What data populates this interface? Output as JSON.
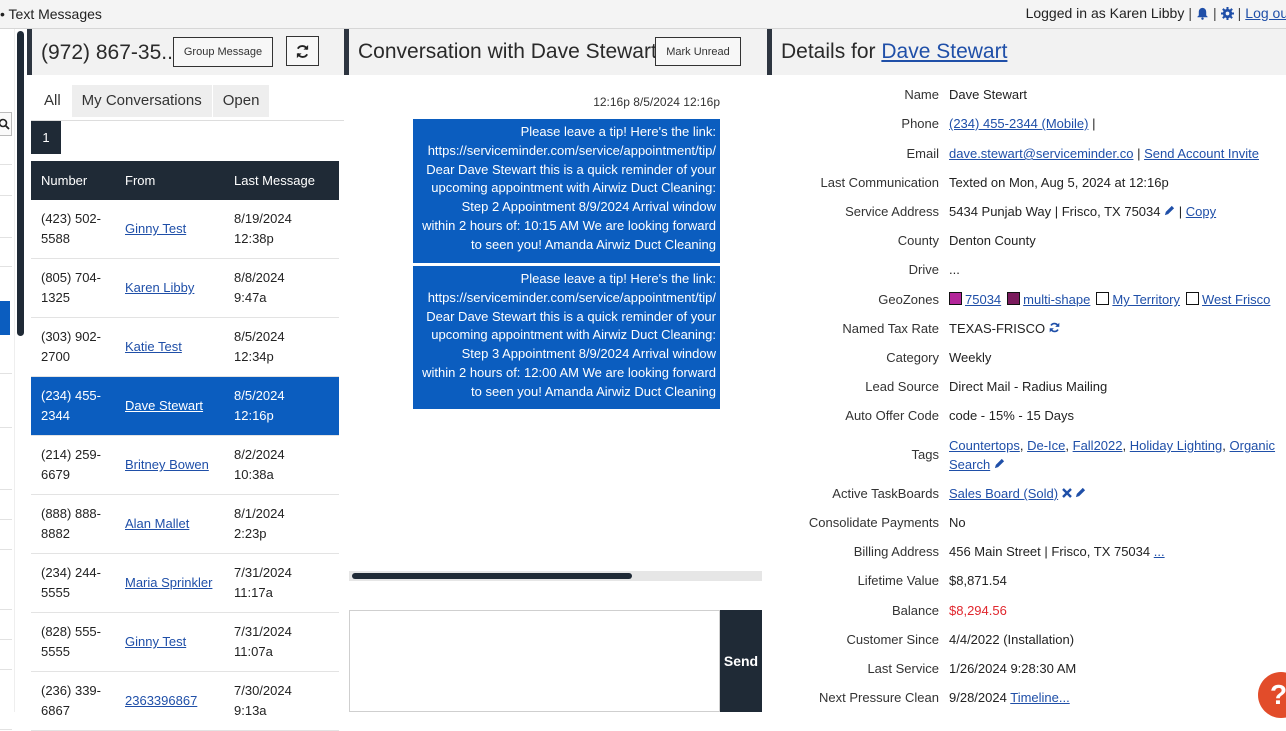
{
  "topbar": {
    "title": "• Text Messages",
    "logged_in": "Logged in as Karen Libby",
    "sep1": "|",
    "sep2": "|",
    "logout": "Log out"
  },
  "left_panel": {
    "phone": "(972) 867-35...",
    "group_message_label": "Group Message",
    "tabs": [
      "All",
      "My Conversations",
      "Open"
    ],
    "page": "1",
    "columns": [
      "Number",
      "From",
      "Last Message"
    ],
    "rows": [
      {
        "number_1": "(423) 502-",
        "number_2": "5588",
        "from": "Ginny Test",
        "date": "8/19/2024",
        "time": "12:38p"
      },
      {
        "number_1": "(805) 704-",
        "number_2": "1325",
        "from": "Karen Libby",
        "date": "8/8/2024",
        "time": "9:47a"
      },
      {
        "number_1": "(303) 902-",
        "number_2": "2700",
        "from": "Katie Test",
        "date": "8/5/2024",
        "time": "12:34p"
      },
      {
        "number_1": "(234) 455-",
        "number_2": "2344",
        "from": "Dave Stewart",
        "date": "8/5/2024",
        "time": "12:16p"
      },
      {
        "number_1": "(214) 259-",
        "number_2": "6679",
        "from": "Britney Bowen",
        "date": "8/2/2024",
        "time": "10:38a"
      },
      {
        "number_1": "(888) 888-",
        "number_2": "8882",
        "from": "Alan Mallet",
        "date": "8/1/2024",
        "time": "2:23p"
      },
      {
        "number_1": "(234) 244-",
        "number_2": "5555",
        "from": "Maria Sprinkler",
        "date": "7/31/2024",
        "time": "11:17a"
      },
      {
        "number_1": "(828) 555-",
        "number_2": "5555",
        "from": "Ginny Test",
        "date": "7/31/2024",
        "time": "11:07a"
      },
      {
        "number_1": "(236) 339-",
        "number_2": "6867",
        "from": "2363396867",
        "date": "7/30/2024",
        "time": "9:13a"
      }
    ]
  },
  "conversation": {
    "title": "Conversation with Dave Stewart",
    "mark_unread_label": "Mark Unread",
    "timestamp": "12:16p 8/5/2024 12:16p",
    "messages": [
      [
        "Please leave a tip! Here's the link:",
        "https://serviceminder.com/service/appointment/tip/",
        "Dear Dave Stewart this is a quick reminder of your",
        "upcoming appointment with Airwiz Duct Cleaning:",
        "Step 2 Appointment 8/9/2024 Arrival window",
        "within 2 hours of: 10:15 AM We are looking forward",
        "to seen you! Amanda Airwiz Duct Cleaning"
      ],
      [
        "Please leave a tip! Here's the link:",
        "https://serviceminder.com/service/appointment/tip/",
        "Dear Dave Stewart this is a quick reminder of your",
        "upcoming appointment with Airwiz Duct Cleaning:",
        "Step 3 Appointment 8/9/2024 Arrival window",
        "within 2 hours of: 12:00 AM We are looking forward",
        "to seen you! Amanda Airwiz Duct Cleaning"
      ]
    ],
    "send_label": "Send"
  },
  "details": {
    "title_prefix": "Details for",
    "customer_name": "Dave Stewart",
    "labels": {
      "name": "Name",
      "phone": "Phone",
      "email": "Email",
      "last_comm": "Last Communication",
      "service_address": "Service Address",
      "county": "County",
      "drive": "Drive",
      "geozones": "GeoZones",
      "tax_rate": "Named Tax Rate",
      "category": "Category",
      "lead_source": "Lead Source",
      "auto_offer": "Auto Offer Code",
      "tags": "Tags",
      "taskboards": "Active TaskBoards",
      "consolidate": "Consolidate Payments",
      "billing": "Billing Address",
      "lifetime": "Lifetime Value",
      "balance": "Balance",
      "since": "Customer Since",
      "last_service": "Last Service",
      "next_pressure": "Next Pressure Clean"
    },
    "name": "Dave Stewart",
    "phone": "(234) 455-2344 (Mobile)",
    "phone_sep": "|",
    "email": "dave.stewart@serviceminder.co",
    "email_sep": "|",
    "send_invite": "Send Account Invite",
    "last_comm": "Texted on Mon, Aug 5, 2024 at 12:16p",
    "service_address": "5434 Punjab Way | Frisco, TX 75034",
    "addr_sep": "|",
    "copy": "Copy",
    "county": "Denton County",
    "drive": "...",
    "geozones": [
      {
        "name": "75034",
        "color": "#b3259a"
      },
      {
        "name": "multi-shape",
        "color": "#7a1a5c"
      },
      {
        "name": "My Territory",
        "color": "#ffffff"
      },
      {
        "name": "West Frisco",
        "color": "#ffffff"
      }
    ],
    "tax_rate": "TEXAS-FRISCO",
    "category": "Weekly",
    "lead_source": "Direct Mail - Radius Mailing",
    "auto_offer": "code - 15% - 15 Days",
    "tags": [
      "Countertops",
      "De-Ice",
      "Fall2022",
      "Holiday Lighting",
      "Organic Search"
    ],
    "tag_sep": ",",
    "taskboard": "Sales Board (Sold)",
    "consolidate": "No",
    "billing": "456 Main Street | Frisco, TX 75034",
    "billing_more": "...",
    "lifetime": "$8,871.54",
    "balance": "$8,294.56",
    "balance_color": "#e0262d",
    "since": "4/4/2022 (Installation)",
    "last_service": "1/26/2024 9:28:30 AM",
    "next_pressure": "9/28/2024",
    "timeline": "Timeline..."
  },
  "help_label": "?"
}
